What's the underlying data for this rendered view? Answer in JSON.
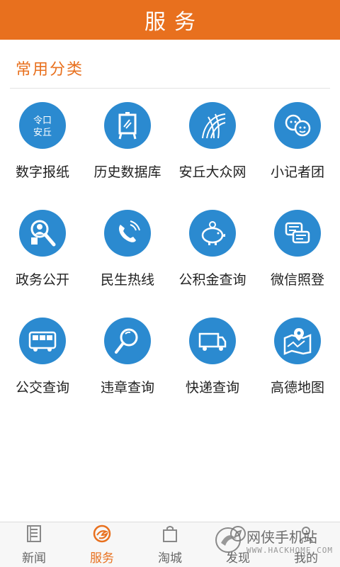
{
  "header": {
    "title": "服务"
  },
  "section": {
    "title": "常用分类"
  },
  "tiles": [
    {
      "label": "数字报纸",
      "icon": "newspaper-icon"
    },
    {
      "label": "历史数据库",
      "icon": "easel-icon"
    },
    {
      "label": "安丘大众网",
      "icon": "globe-icon"
    },
    {
      "label": "小记者团",
      "icon": "kids-icon"
    },
    {
      "label": "政务公开",
      "icon": "magnifier-person-icon"
    },
    {
      "label": "民生热线",
      "icon": "phone-icon"
    },
    {
      "label": "公积金查询",
      "icon": "piggy-bank-icon"
    },
    {
      "label": "微信照登",
      "icon": "chat-bubbles-icon"
    },
    {
      "label": "公交查询",
      "icon": "bus-icon"
    },
    {
      "label": "违章查询",
      "icon": "search-icon"
    },
    {
      "label": "快递查询",
      "icon": "truck-icon"
    },
    {
      "label": "高德地图",
      "icon": "map-pin-icon"
    }
  ],
  "tabbar": {
    "tabs": [
      {
        "label": "新闻",
        "icon": "newspaper-tab-icon",
        "active": false
      },
      {
        "label": "服务",
        "icon": "service-tab-icon",
        "active": true
      },
      {
        "label": "淘城",
        "icon": "shopping-bag-icon",
        "active": false
      },
      {
        "label": "发现",
        "icon": "discover-icon",
        "active": false
      },
      {
        "label": "我的",
        "icon": "user-icon",
        "active": false
      }
    ]
  },
  "watermark": {
    "text": "网侠手机站",
    "sub": "WWW.HACKHOME.COM"
  },
  "colors": {
    "accent": "#e8701e",
    "icon_bg": "#2b8ad0"
  }
}
